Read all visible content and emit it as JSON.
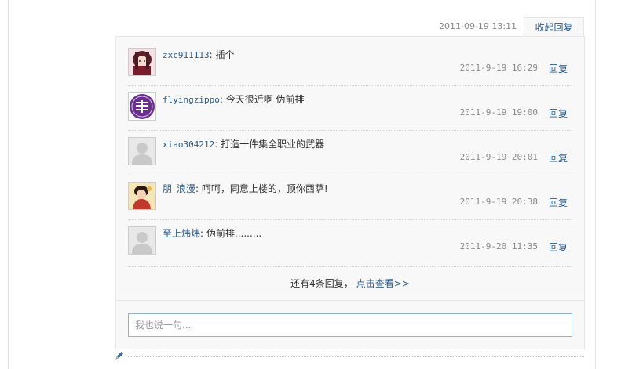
{
  "post": {
    "timestamp": "2011-09-19 13:11",
    "collapse_label": "收起回复"
  },
  "replies": [
    {
      "user": "zxc911113",
      "sep": ": ",
      "text": "插个",
      "time": "2011-9-19 16:29",
      "reply_label": "回复",
      "avatar_icon": "anime-avatar-icon"
    },
    {
      "user": "flyingzippo",
      "sep": ": ",
      "text": "今天很近啊 伪前排",
      "time": "2011-9-19 19:00",
      "reply_label": "回复",
      "avatar_icon": "purple-badge-avatar-icon"
    },
    {
      "user": "xiao304212",
      "sep": ": ",
      "text": "打造一件集全职业的武器",
      "time": "2011-9-19 20:01",
      "reply_label": "回复",
      "avatar_icon": "default-avatar-icon"
    },
    {
      "user": "朋_浪漫",
      "sep": ": ",
      "text": "呵呵，同意上楼的，顶你西萨!",
      "time": "2011-9-19 20:38",
      "reply_label": "回复",
      "avatar_icon": "character-avatar-icon"
    },
    {
      "user": "至上炜炜",
      "sep": ": ",
      "text": "伪前排.........",
      "time": "2011-9-20 11:35",
      "reply_label": "回复",
      "avatar_icon": "default-avatar-icon"
    }
  ],
  "more": {
    "text": "还有4条回复，",
    "link_label": "点击查看>>"
  },
  "input": {
    "placeholder": "我也说一句..."
  },
  "colors": {
    "link": "#2b5c8e",
    "panel_bg": "#f8f8f8",
    "border": "#e6e6e6",
    "input_border": "#8fb3c9"
  }
}
